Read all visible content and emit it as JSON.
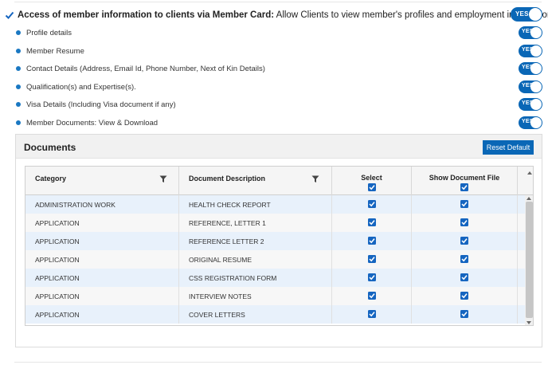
{
  "main_setting": {
    "label_bold": "Access of member information to clients via Member Card:",
    "label_rest": " Allow Clients to view member's profiles and employment information.",
    "toggle": "YES"
  },
  "sub_settings": [
    {
      "label": "Profile details",
      "toggle": "YES"
    },
    {
      "label": "Member Resume",
      "toggle": "YES"
    },
    {
      "label": "Contact Details (Address, Email Id, Phone Number, Next of Kin Details)",
      "toggle": "YES"
    },
    {
      "label": "Qualification(s) and Expertise(s).",
      "toggle": "YES"
    },
    {
      "label": "Visa Details (Including Visa document if any)",
      "toggle": "YES"
    },
    {
      "label": "Member Documents: View & Download",
      "toggle": "YES"
    }
  ],
  "documents": {
    "title": "Documents",
    "reset_button": "Reset Default",
    "columns": {
      "category": "Category",
      "description": "Document Description",
      "select": "Select",
      "show_file": "Show Document File"
    },
    "rows": [
      {
        "category": "ADMINISTRATION WORK",
        "description": "HEALTH CHECK REPORT",
        "select": true,
        "show_file": true
      },
      {
        "category": "APPLICATION",
        "description": "REFERENCE, LETTER 1",
        "select": true,
        "show_file": true
      },
      {
        "category": "APPLICATION",
        "description": "REFERENCE LETTER 2",
        "select": true,
        "show_file": true
      },
      {
        "category": "APPLICATION",
        "description": "ORIGINAL RESUME",
        "select": true,
        "show_file": true
      },
      {
        "category": "APPLICATION",
        "description": "CSS REGISTRATION FORM",
        "select": true,
        "show_file": true
      },
      {
        "category": "APPLICATION",
        "description": "INTERVIEW NOTES",
        "select": true,
        "show_file": true
      },
      {
        "category": "APPLICATION",
        "description": "COVER LETTERS",
        "select": true,
        "show_file": true
      }
    ]
  },
  "colors": {
    "accent": "#0a67b6",
    "dot": "#1a78c2",
    "row_highlight": "#e8f1fb"
  }
}
